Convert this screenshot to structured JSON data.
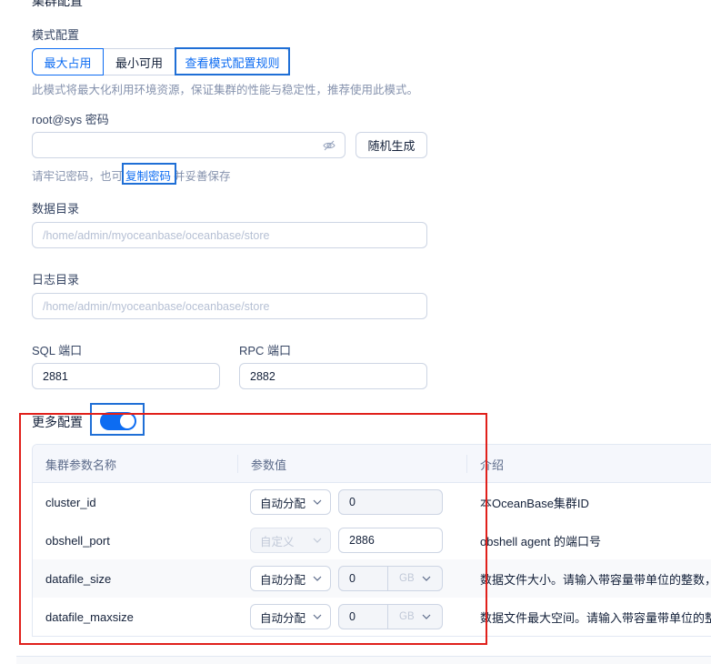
{
  "section_title": "集群配置",
  "mode": {
    "label": "模式配置",
    "options": [
      "最大占用",
      "最小可用"
    ],
    "selected": "最大占用",
    "rules_link": "查看模式配置规则",
    "description": "此模式将最大化利用环境资源，保证集群的性能与稳定性，推荐使用此模式。"
  },
  "password": {
    "label": "root@sys 密码",
    "value": "",
    "icon": "eye-invisible-icon",
    "generate_button": "随机生成",
    "hint_prefix": "请牢记密码，也可",
    "copy_link": "复制密码",
    "hint_suffix": "并妥善保存"
  },
  "data_dir": {
    "label": "数据目录",
    "placeholder": "/home/admin/myoceanbase/oceanbase/store"
  },
  "log_dir": {
    "label": "日志目录",
    "placeholder": "/home/admin/myoceanbase/oceanbase/store"
  },
  "sql_port": {
    "label": "SQL 端口",
    "value": "2881"
  },
  "rpc_port": {
    "label": "RPC 端口",
    "value": "2882"
  },
  "more_config": {
    "label": "更多配置",
    "enabled": true
  },
  "params_table": {
    "headers": [
      "集群参数名称",
      "参数值",
      "介绍"
    ],
    "rows": [
      {
        "name": "cluster_id",
        "mode": "自动分配",
        "mode_disabled": false,
        "value": "0",
        "value_disabled": true,
        "unit": "",
        "intro": "本OceanBase集群ID"
      },
      {
        "name": "obshell_port",
        "mode": "自定义",
        "mode_disabled": true,
        "value": "2886",
        "value_disabled": false,
        "unit": "",
        "intro": "obshell agent 的端口号"
      },
      {
        "name": "datafile_size",
        "mode": "自动分配",
        "mode_disabled": false,
        "value": "0",
        "value_disabled": true,
        "unit": "GB",
        "intro": "数据文件大小。请输入带容量带单位的整数，如"
      },
      {
        "name": "datafile_maxsize",
        "mode": "自动分配",
        "mode_disabled": false,
        "value": "0",
        "value_disabled": true,
        "unit": "GB",
        "intro": "数据文件最大空间。请输入带容量带单位的整数"
      }
    ]
  },
  "colors": {
    "primary": "#0d6cf2",
    "highlight_blue": "#1f6fd6",
    "highlight_red": "#e0201b"
  }
}
